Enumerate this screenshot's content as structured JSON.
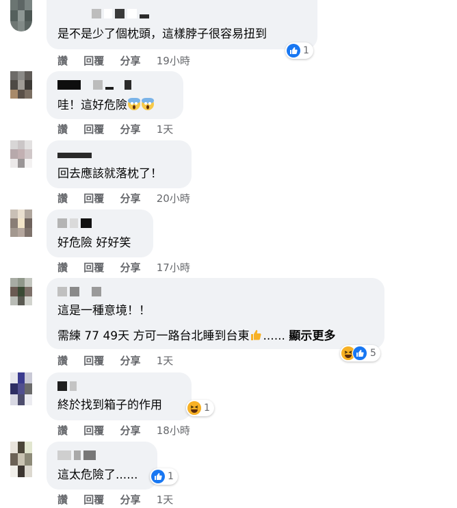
{
  "actions": {
    "read": "讚",
    "reply": "回覆",
    "share": "分享"
  },
  "comments": [
    {
      "text": "是不是少了個枕頭，這樣脖子很容易扭到",
      "time": "19小時",
      "reaction_count": "1",
      "reaction_icons": [
        "like-icon"
      ]
    },
    {
      "text": "哇！這好危險",
      "emoji": [
        "screaming-face-icon",
        "screaming-face-icon"
      ],
      "time": "1天"
    },
    {
      "text": "回去應該就落枕了！",
      "time": "20小時"
    },
    {
      "text": "好危險 好好笑",
      "time": "17小時"
    },
    {
      "text_line1": "這是一種意境！！",
      "text_line2": "需練 77 49天 方可一路台北睡到台東",
      "ellipsis": "......",
      "see_more": "顯示更多",
      "emoji": [
        "thumbs-up-icon"
      ],
      "time": "1天",
      "reaction_count": "5",
      "reaction_icons": [
        "haha-icon",
        "like-icon"
      ]
    },
    {
      "text": "終於找到箱子的作用",
      "time": "18小時",
      "reaction_count": "1",
      "reaction_icons": [
        "haha-icon"
      ]
    },
    {
      "text": "這太危險了......",
      "time": "1天",
      "reaction_count": "1",
      "reaction_icons": [
        "like-icon"
      ]
    }
  ],
  "colors": {
    "bubble": "#f0f2f5",
    "meta_text": "#65676b",
    "like": "#1877f2",
    "haha": "#f7b125"
  }
}
